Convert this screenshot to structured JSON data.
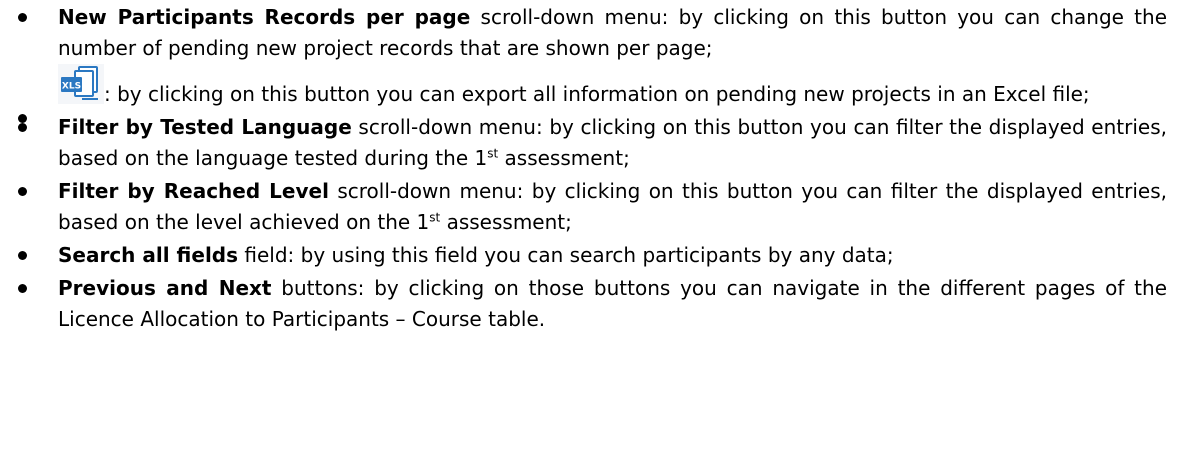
{
  "items": [
    {
      "bold": "New Participants Records per page",
      "text": " scroll-down menu: by clicking on this button you can change the number of pending new project records that are shown per page;"
    },
    {
      "icon": "xls-export-icon",
      "icon_label": "XLS",
      "text": ": by clicking on this button you can export all information on pending new projects in an Excel file;"
    },
    {
      "bold": "Filter by Tested Language",
      "text_before_sup": " scroll-down menu: by clicking on this button you can filter the displayed entries, based on the language tested during the 1",
      "sup": "st",
      "text_after_sup": " assessment;"
    },
    {
      "bold": "Filter by Reached Level",
      "text_before_sup": " scroll-down menu: by clicking on this button you can filter the displayed entries, based on the level achieved on the 1",
      "sup": "st",
      "text_after_sup": " assessment;"
    },
    {
      "bold": "Search all fields",
      "text": " field: by using this field you can search participants by any data;"
    },
    {
      "bold": "Previous and Next",
      "text": " buttons: by clicking on those buttons you can navigate in the different pages of the Licence Allocation to Participants – Course table."
    }
  ],
  "colors": {
    "text": "#000000",
    "icon_blue": "#2b78c2",
    "icon_dark_blue": "#1b5a94"
  }
}
